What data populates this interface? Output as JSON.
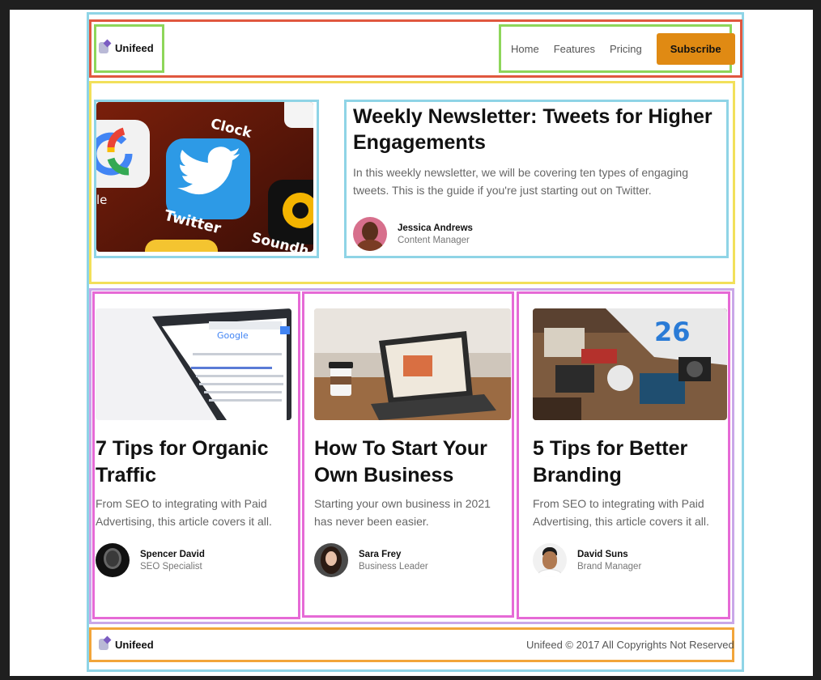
{
  "brand": {
    "name": "Unifeed",
    "logo_icon": "unicorn-icon"
  },
  "nav": {
    "items": [
      "Home",
      "Features",
      "Pricing"
    ],
    "subscribe_label": "Subscribe",
    "accent": "#e08a13"
  },
  "featured": {
    "image_alt": "Twitter app icon on phone home screen",
    "icon_labels": {
      "top": "Clock",
      "middle": "Twitter",
      "bottom": "Soundh",
      "left": "le"
    },
    "title": "Weekly Newsletter: Tweets for Higher Engagements",
    "description": "In this weekly newsletter, we will be covering ten types of engaging tweets. This is the guide if you're just starting out on Twitter.",
    "author_name": "Jessica Andrews",
    "author_role": "Content Manager"
  },
  "cards": [
    {
      "title": "7 Tips for Organic Traffic",
      "description": "From SEO to integrating with Paid Advertising, this article covers it all.",
      "author_name": "Spencer David",
      "author_role": "SEO Specialist"
    },
    {
      "title": "How To Start Your Own Business",
      "description": "Starting your own business in 2021 has never been easier.",
      "author_name": "Sara Frey",
      "author_role": "Business Leader"
    },
    {
      "title": "5 Tips for Better Branding",
      "description": "From SEO to integrating with Paid Advertising, this article covers it all.",
      "author_name": "David Suns",
      "author_role": "Brand Manager"
    }
  ],
  "footer": {
    "brand": "Unifeed",
    "copyright": "Unifeed © 2017 All Copyrights Not Reserved"
  },
  "annotation_colors": {
    "outer": "#8fd4e6",
    "header": "#e0573f",
    "header_groups": "#8ed65a",
    "featured_section": "#f2e05a",
    "featured_parts": "#8fd4e6",
    "cards_section": "#c9a7e8",
    "cards": "#e66ad6",
    "footer": "#f2a53a"
  }
}
